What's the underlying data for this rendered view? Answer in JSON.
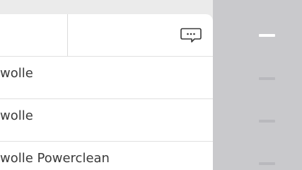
{
  "header": {
    "comment_icon": "speech-bubble-ellipsis-icon"
  },
  "list": {
    "items": [
      {
        "label": "wolle"
      },
      {
        "label": "wolle"
      },
      {
        "label": "wolle Powerclean"
      }
    ]
  },
  "pager": {
    "active_index": 0,
    "count": 4
  },
  "colors": {
    "panel": "#c9c9cc",
    "active_dash": "#ffffff",
    "inactive_dash": "#b9b9bd"
  }
}
